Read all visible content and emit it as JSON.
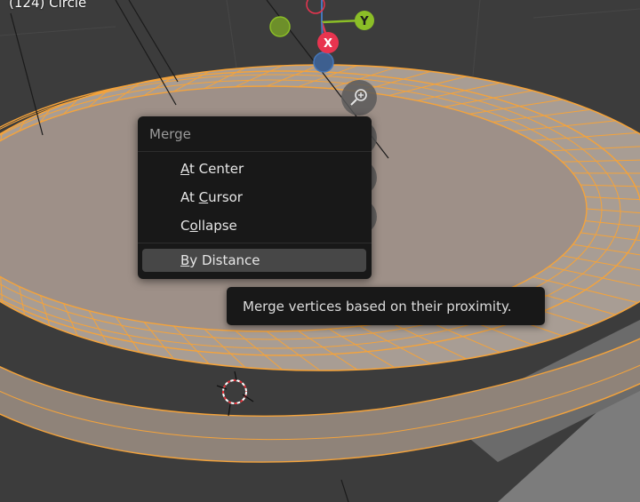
{
  "viewport": {
    "object_label": "(124) Circle"
  },
  "gizmo": {
    "x_label": "X",
    "y_label": "Y",
    "x_color": "#e8344f",
    "y_color": "#8bbe27",
    "z_color": "#4677b9"
  },
  "merge_menu": {
    "title": "Merge",
    "items": [
      {
        "label": "At Center",
        "underline": "A"
      },
      {
        "label": "At Cursor",
        "underline": "C"
      },
      {
        "label": "Collapse",
        "underline": "o"
      },
      {
        "label": "By Distance",
        "underline": "B",
        "active": true
      }
    ]
  },
  "tooltip": {
    "text": "Merge vertices based on their proximity."
  },
  "colors": {
    "mesh_edge": "#f4a33b",
    "mesh_face": "#9e9088",
    "menu_bg": "#181818",
    "menu_active": "#474747"
  }
}
